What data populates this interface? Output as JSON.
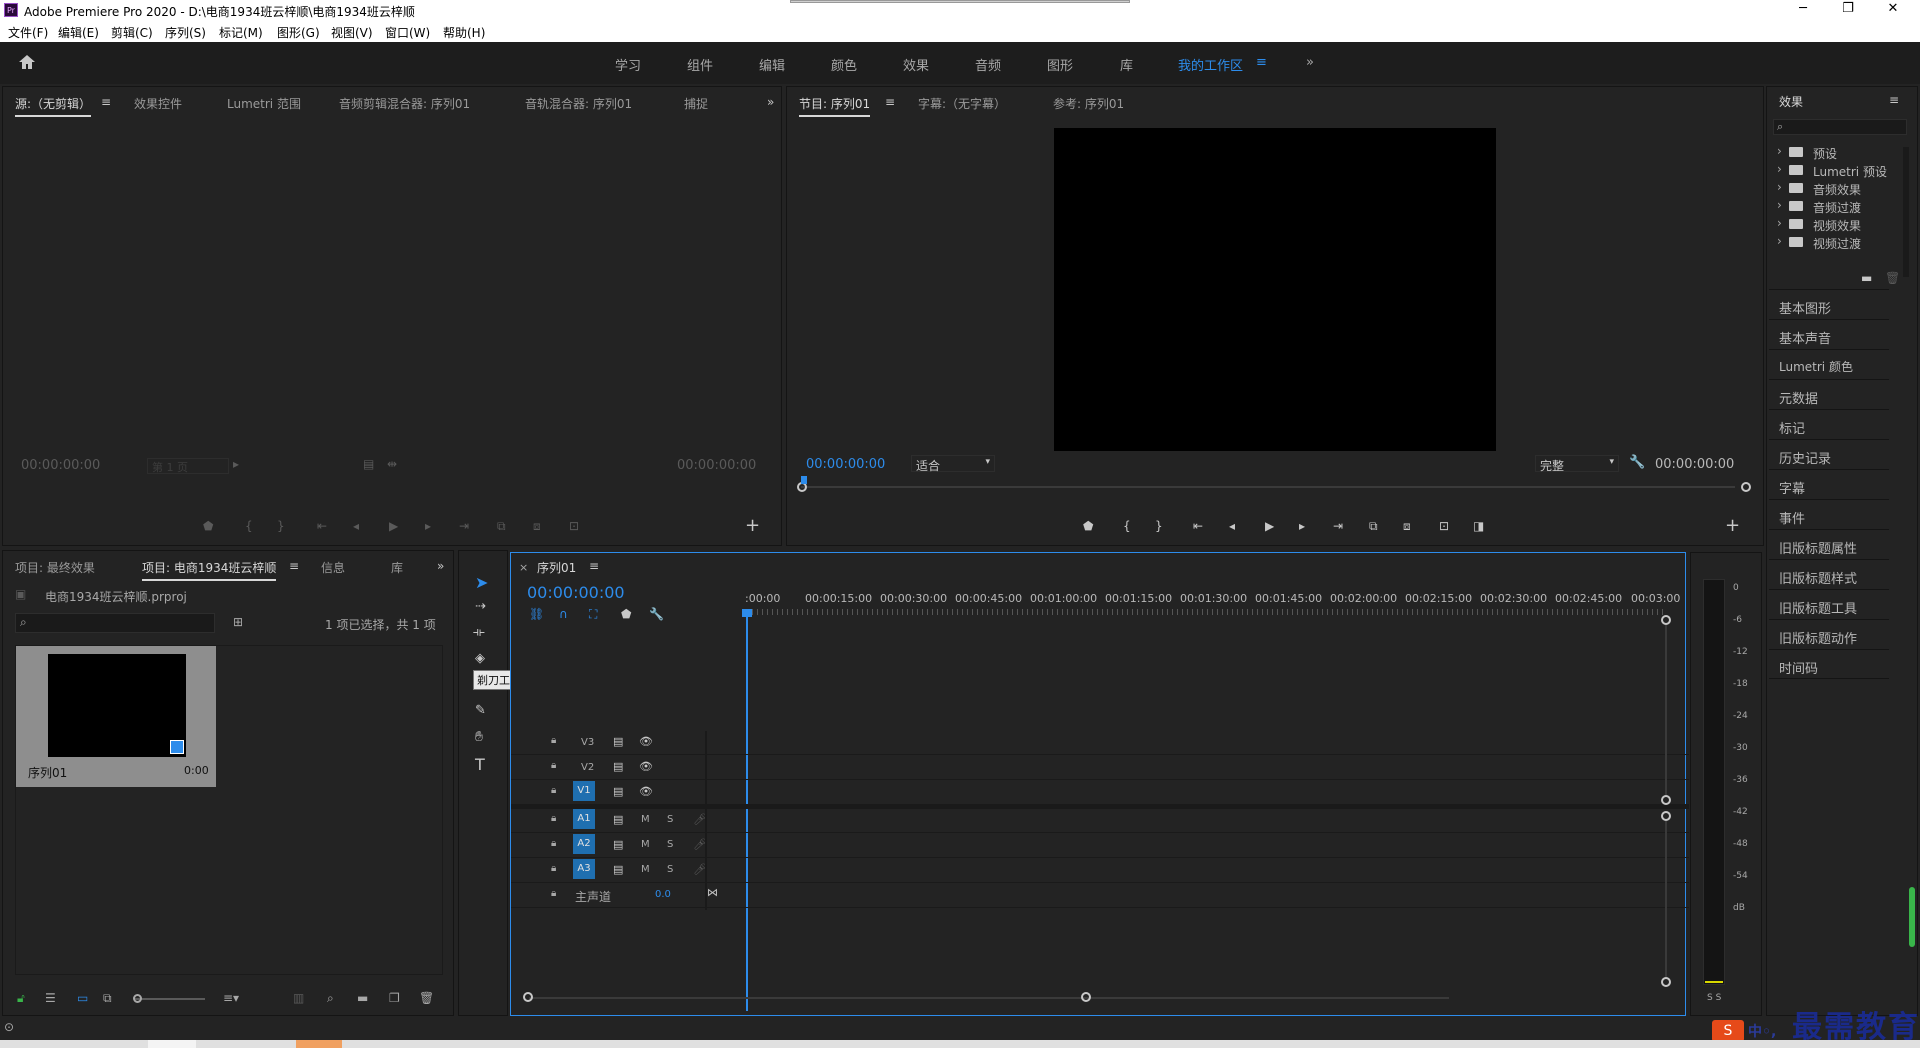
{
  "titlebar": {
    "title": "Adobe Premiere Pro 2020 - D:\\电商1934班云梓顺\\电商1934班云梓顺",
    "logo": "Pr"
  },
  "menu": [
    "文件(F)",
    "编辑(E)",
    "剪辑(C)",
    "序列(S)",
    "标记(M)",
    "图形(G)",
    "视图(V)",
    "窗口(W)",
    "帮助(H)"
  ],
  "workspaces": [
    "学习",
    "组件",
    "编辑",
    "颜色",
    "效果",
    "音频",
    "图形",
    "库",
    "我的工作区"
  ],
  "source_panel": {
    "tabs": [
      "源:（无剪辑）",
      "效果控件",
      "Lumetri 范围",
      "音频剪辑混合器: 序列01",
      "音轨混合器: 序列01",
      "捕捉"
    ],
    "timecode_left": "00:00:00:00",
    "page_select": "第 1 页",
    "timecode_right": "00:00:00:00"
  },
  "program_panel": {
    "tabs": [
      "节目: 序列01",
      "字幕:（无字幕）",
      "参考: 序列01"
    ],
    "timecode_left": "00:00:00:00",
    "fit_select": "适合",
    "quality_select": "完整",
    "timecode_right": "00:00:00:00"
  },
  "project_panel": {
    "tabs": [
      "项目: 最终效果",
      "项目: 电商1934班云梓顺",
      "信息",
      "库"
    ],
    "file": "电商1934班云梓顺.prproj",
    "selection_info": "1 项已选择，共 1 项",
    "thumb_name": "序列01",
    "thumb_duration": "0:00"
  },
  "tools": {
    "tooltip": "剃刀工具 (C)"
  },
  "timeline": {
    "tab": "序列01",
    "timecode": "00:00:00:00",
    "ruler": [
      ":00:00",
      "00:00:15:00",
      "00:00:30:00",
      "00:00:45:00",
      "00:01:00:00",
      "00:01:15:00",
      "00:01:30:00",
      "00:01:45:00",
      "00:02:00:00",
      "00:02:15:00",
      "00:02:30:00",
      "00:02:45:00",
      "00:03:00"
    ],
    "video_tracks": [
      "V3",
      "V2",
      "V1"
    ],
    "audio_tracks": [
      "A1",
      "A2",
      "A3"
    ],
    "mute": "M",
    "solo": "S",
    "master_label": "主声道",
    "master_value": "0.0"
  },
  "meter": {
    "scale": [
      "0",
      "-6",
      "-12",
      "-18",
      "-24",
      "-30",
      "-36",
      "-42",
      "-48",
      "-54",
      "dB"
    ],
    "solo": "S S"
  },
  "effects_panel": {
    "title": "效果",
    "folders": [
      "预设",
      "Lumetri 预设",
      "音频效果",
      "音频过渡",
      "视频效果",
      "视频过渡"
    ]
  },
  "side_panels": [
    "基本图形",
    "基本声音",
    "Lumetri 颜色",
    "元数据",
    "标记",
    "历史记录",
    "字幕",
    "事件",
    "旧版标题属性",
    "旧版标题样式",
    "旧版标题工具",
    "旧版标题动作",
    "时间码"
  ],
  "watermark": "最需教育",
  "colors": {
    "accent": "#2d8ceb",
    "track_blue": "#1f6fb0"
  }
}
